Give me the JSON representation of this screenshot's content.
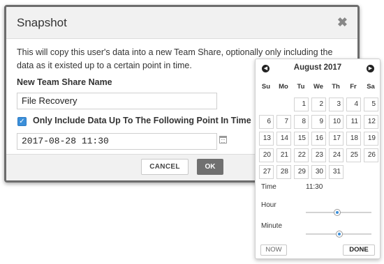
{
  "modal": {
    "title": "Snapshot",
    "close_glyph": "✖",
    "description": "This will copy this user's data into a new Team Share, optionally only including the data as it existed up to a certain point in time.",
    "name_label": "New Team Share Name",
    "name_value": "File Recovery",
    "checkbox_checked": true,
    "checkbox_label": "Only Include Data Up To The Following Point In Time",
    "date_value": "2017-08-28 11:30",
    "cancel_label": "CANCEL",
    "ok_label": "OK",
    "ok_color": "#707070",
    "accent_color": "#3b8fd9"
  },
  "picker": {
    "month_label": "August 2017",
    "prev_icon": "chevron-left-icon",
    "next_icon": "chevron-right-icon",
    "weekdays": [
      "Su",
      "Mo",
      "Tu",
      "We",
      "Th",
      "Fr",
      "Sa"
    ],
    "days": [
      "1",
      "2",
      "3",
      "4",
      "5",
      "6",
      "7",
      "8",
      "9",
      "10",
      "11",
      "12",
      "13",
      "14",
      "15",
      "16",
      "17",
      "18",
      "19",
      "20",
      "21",
      "22",
      "23",
      "24",
      "25",
      "26",
      "27",
      "28",
      "29",
      "30",
      "31"
    ],
    "first_weekday_index": 2,
    "time_label": "Time",
    "time_value": "11:30",
    "hour_label": "Hour",
    "minute_label": "Minute",
    "hour_value": 11,
    "hour_max": 23,
    "minute_value": 30,
    "minute_max": 59,
    "now_label": "NOW",
    "done_label": "DONE"
  }
}
